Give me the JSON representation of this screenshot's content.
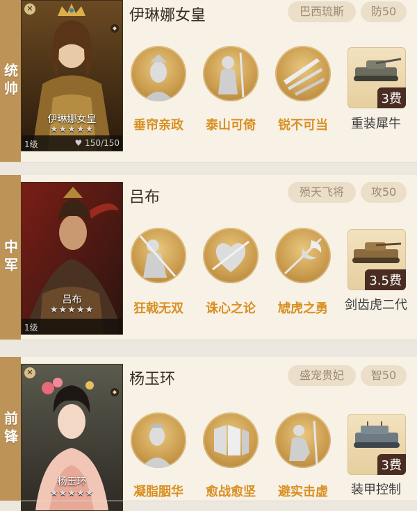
{
  "rows": [
    {
      "position_label": "统帅",
      "hero": {
        "name": "伊琳娜女皇",
        "card_name": "伊琳娜女皇",
        "stars": "★★★★★",
        "level": "1级",
        "hp": "150/150"
      },
      "tags": {
        "title": "巴西琉斯",
        "stat": "防50"
      },
      "skills": [
        "垂帘亲政",
        "泰山可倚",
        "锐不可当"
      ],
      "tank": {
        "name": "重装犀牛",
        "cost": "3费"
      }
    },
    {
      "position_label": "中军",
      "hero": {
        "name": "吕布",
        "card_name": "吕布",
        "stars": "★★★★★",
        "level": "1级"
      },
      "tags": {
        "title": "殒天飞将",
        "stat": "攻50"
      },
      "skills": [
        "狂戟无双",
        "诛心之论",
        "虓虎之勇"
      ],
      "tank": {
        "name": "剑齿虎二代",
        "cost": "3.5费"
      }
    },
    {
      "position_label": "前锋",
      "hero": {
        "name": "杨玉环",
        "card_name": "杨玉环",
        "stars": "★★★★★"
      },
      "tags": {
        "title": "盛宠贵妃",
        "stat": "智50"
      },
      "skills": [
        "凝脂胭华",
        "愈战愈坚",
        "避实击虚"
      ],
      "tank": {
        "name": "装甲控制",
        "cost": "3费"
      }
    }
  ],
  "colors": {
    "tab": "#bd9358",
    "skill_label": "#d99022",
    "tag_bg": "#ebdfca",
    "cost_badge": "#4a2c22"
  }
}
